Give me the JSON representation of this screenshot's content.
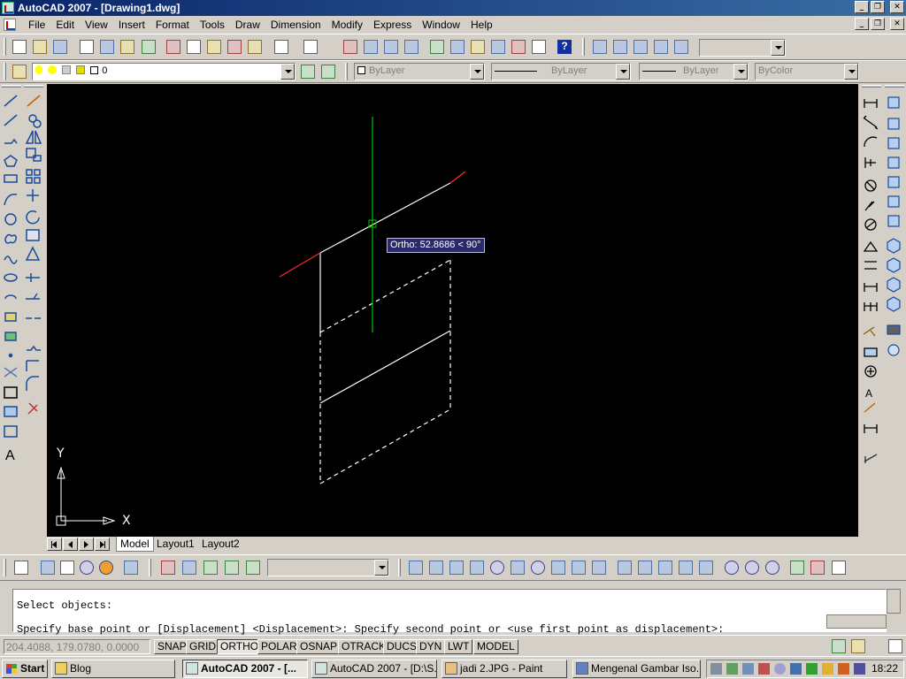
{
  "window": {
    "title": "AutoCAD 2007 - [Drawing1.dwg]",
    "min_icon": "minimize-icon",
    "restore_icon": "restore-icon",
    "close_icon": "close-icon"
  },
  "menu": [
    "File",
    "Edit",
    "View",
    "Insert",
    "Format",
    "Tools",
    "Draw",
    "Dimension",
    "Modify",
    "Express",
    "Window",
    "Help"
  ],
  "toolbars": {
    "layer_value": "0",
    "color_value": "ByLayer",
    "linetype_value": "ByLayer",
    "lineweight_value": "ByLayer",
    "plotstyle_value": "ByColor",
    "help_glyph": "?"
  },
  "drawing": {
    "tooltip": "Ortho: 52.8686 < 90°",
    "ucs_y": "Y",
    "ucs_x": "X",
    "background": "#000000",
    "line_color": "#ffffff",
    "rubberband_color": "#ff2a2a",
    "ortho_axis_color": "#00c000"
  },
  "layout_tabs": [
    "Model",
    "Layout1",
    "Layout2"
  ],
  "command": {
    "line1": "Select objects:",
    "line2": "Specify base point or [Displacement] <Displacement>: Specify second point or <use first point as displacement>:"
  },
  "status": {
    "coords": "204.4088, 179.0780, 0.0000",
    "buttons": [
      "SNAP",
      "GRID",
      "ORTHO",
      "POLAR",
      "OSNAP",
      "OTRACK",
      "DUCS",
      "DYN",
      "LWT",
      "MODEL"
    ]
  },
  "taskbar": {
    "start": "Start",
    "tasks": [
      "Blog",
      "AutoCAD 2007 - [...",
      "AutoCAD 2007 - [D:\\S...",
      "jadi 2.JPG - Paint",
      "Mengenal Gambar Iso..."
    ],
    "clock": "18:22"
  }
}
